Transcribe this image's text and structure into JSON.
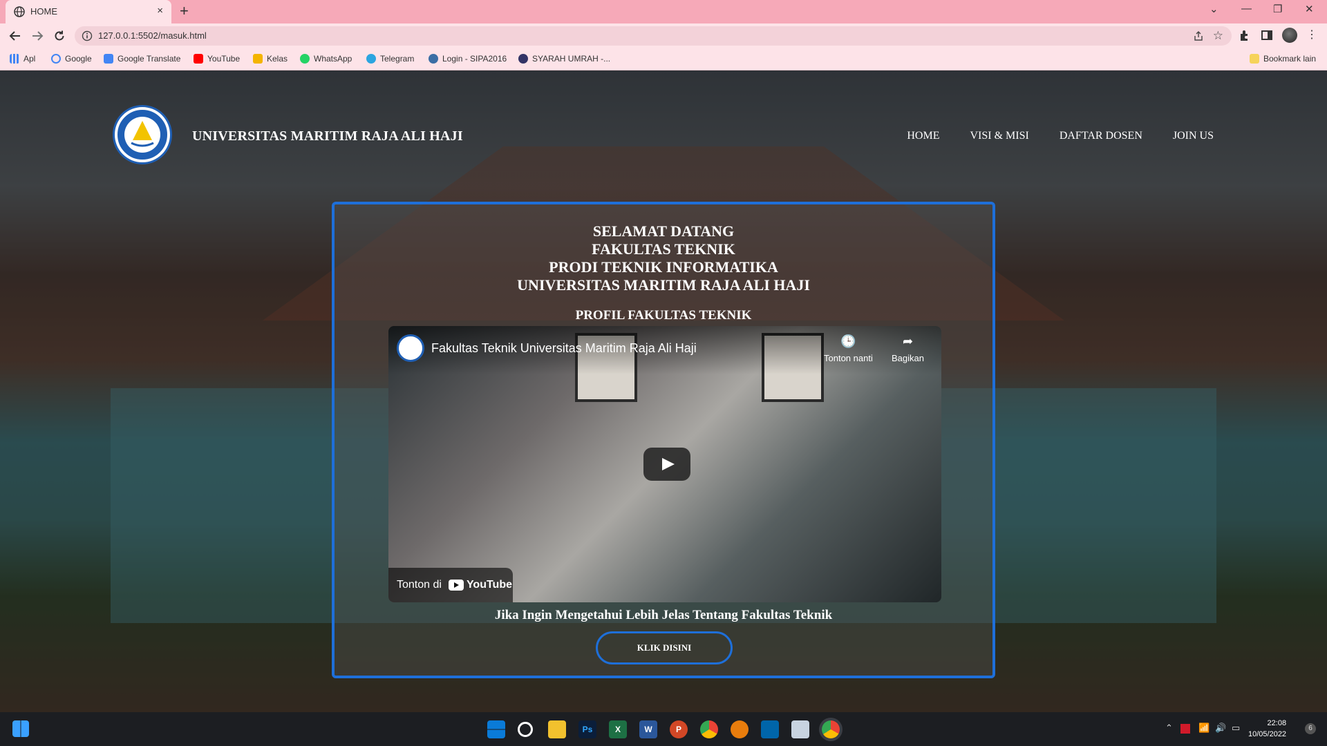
{
  "browser": {
    "tab_title": "HOME",
    "tab_close": "×",
    "new_tab": "+",
    "url": "127.0.0.1:5502/masuk.html",
    "window_controls": [
      "⌄",
      "—",
      "❐",
      "✕"
    ],
    "bookmarks": [
      {
        "label": "Apl",
        "icon": "apps-grid-icon",
        "color": "#4285f4"
      },
      {
        "label": "Google",
        "icon": "google-icon",
        "color": "#4285f4"
      },
      {
        "label": "Google Translate",
        "icon": "translate-icon",
        "color": "#4285f4"
      },
      {
        "label": "YouTube",
        "icon": "youtube-icon",
        "color": "#ff0000"
      },
      {
        "label": "Kelas",
        "icon": "classroom-icon",
        "color": "#f4b400"
      },
      {
        "label": "WhatsApp",
        "icon": "whatsapp-icon",
        "color": "#25d366"
      },
      {
        "label": "Telegram",
        "icon": "telegram-icon",
        "color": "#2ca5e0"
      },
      {
        "label": "Login - SIPA2016",
        "icon": "sipa-icon",
        "color": "#3b6ea5"
      },
      {
        "label": "SYARAH UMRAH -...",
        "icon": "syarah-icon",
        "color": "#333366"
      }
    ],
    "other_bookmarks": "Bookmark lain"
  },
  "site": {
    "title": "UNIVERSITAS MARITIM RAJA ALI HAJI",
    "nav": [
      "HOME",
      "VISI & MISI",
      "DAFTAR DOSEN",
      "JOIN US"
    ]
  },
  "card": {
    "welcome_lines": [
      "SELAMAT DATANG",
      "FAKULTAS TEKNIK",
      "PRODI TEKNIK INFORMATIKA",
      "UNIVERSITAS MARITIM RAJA ALI HAJI"
    ],
    "profile_title": "PROFIL FAKULTAS TEKNIK",
    "video": {
      "title": "Fakultas Teknik Universitas Maritim Raja Ali Haji",
      "watch_later": "Tonton nanti",
      "share": "Bagikan",
      "watch_on": "Tonton di",
      "youtube": "YouTube"
    },
    "info_text": "Jika Ingin Mengetahui Lebih Jelas Tentang Fakultas Teknik",
    "cta_label": "KLIK DISINI"
  },
  "taskbar": {
    "apps": [
      "windows-start",
      "search",
      "file-explorer",
      "photoshop",
      "excel",
      "word",
      "powerpoint",
      "chrome",
      "blender",
      "vscode",
      "box-app",
      "chrome-active"
    ],
    "time": "22:08",
    "date": "10/05/2022",
    "notification_count": "6"
  },
  "colors": {
    "accent": "#1e6fd9",
    "tab_bar": "#f6a9b8",
    "toolbar": "#fde3e8"
  }
}
